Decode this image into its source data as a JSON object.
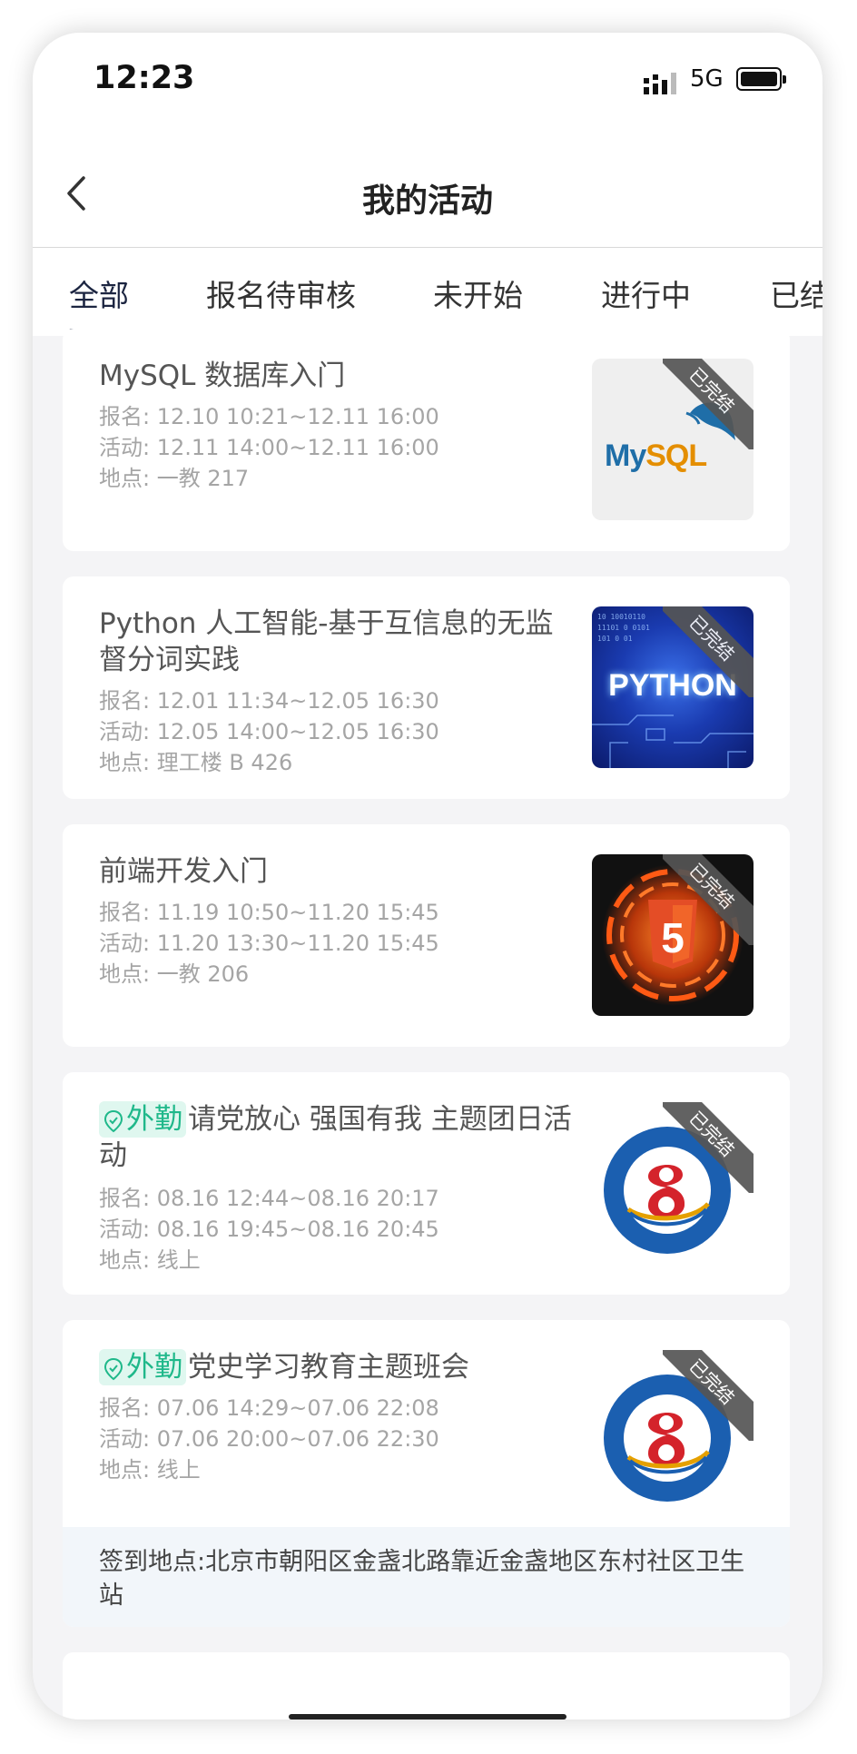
{
  "status_bar": {
    "time": "12:23",
    "network": "5G"
  },
  "header": {
    "title": "我的活动"
  },
  "tabs": [
    {
      "label": "全部",
      "active": true
    },
    {
      "label": "报名待审核"
    },
    {
      "label": "未开始"
    },
    {
      "label": "进行中"
    },
    {
      "label": "已结"
    }
  ],
  "activities": [
    {
      "title": "MySQL 数据库入门",
      "signup": "报名: 12.10 10:21~12.11 16:00",
      "event": "活动: 12.11 14:00~12.11 16:00",
      "location": "地点: 一教 217",
      "status": "已完结",
      "image": "mysql-logo",
      "image_text": "MySQL"
    },
    {
      "title": "Python 人工智能-基于互信息的无监督分词实践",
      "signup": "报名: 12.01 11:34~12.05 16:30",
      "event": "活动: 12.05 14:00~12.05 16:30",
      "location": "地点: 理工楼 B 426",
      "status": "已完结",
      "image": "python-banner",
      "image_text": "PYTHON"
    },
    {
      "title": "前端开发入门",
      "signup": "报名: 11.19 10:50~11.20 15:45",
      "event": "活动: 11.20 13:30~11.20 15:45",
      "location": "地点: 一教 206",
      "status": "已完结",
      "image": "html5-logo",
      "image_text": "5"
    },
    {
      "tag": "外勤",
      "title": "请党放心 强国有我 主题团日活动",
      "signup": "报名: 08.16 12:44~08.16 20:17",
      "event": "活动: 08.16 19:45~08.16 20:45",
      "location": "地点: 线上",
      "status": "已完结",
      "image": "class-badge"
    },
    {
      "tag": "外勤",
      "title": "党史学习教育主题班会",
      "signup": "报名: 07.06 14:29~07.06 22:08",
      "event": "活动: 07.06 20:00~07.06 22:30",
      "location": "地点: 线上",
      "status": "已完结",
      "image": "class-badge",
      "checkin_location": "签到地点:北京市朝阳区金盏北路靠近金盏地区东村社区卫生站"
    }
  ]
}
